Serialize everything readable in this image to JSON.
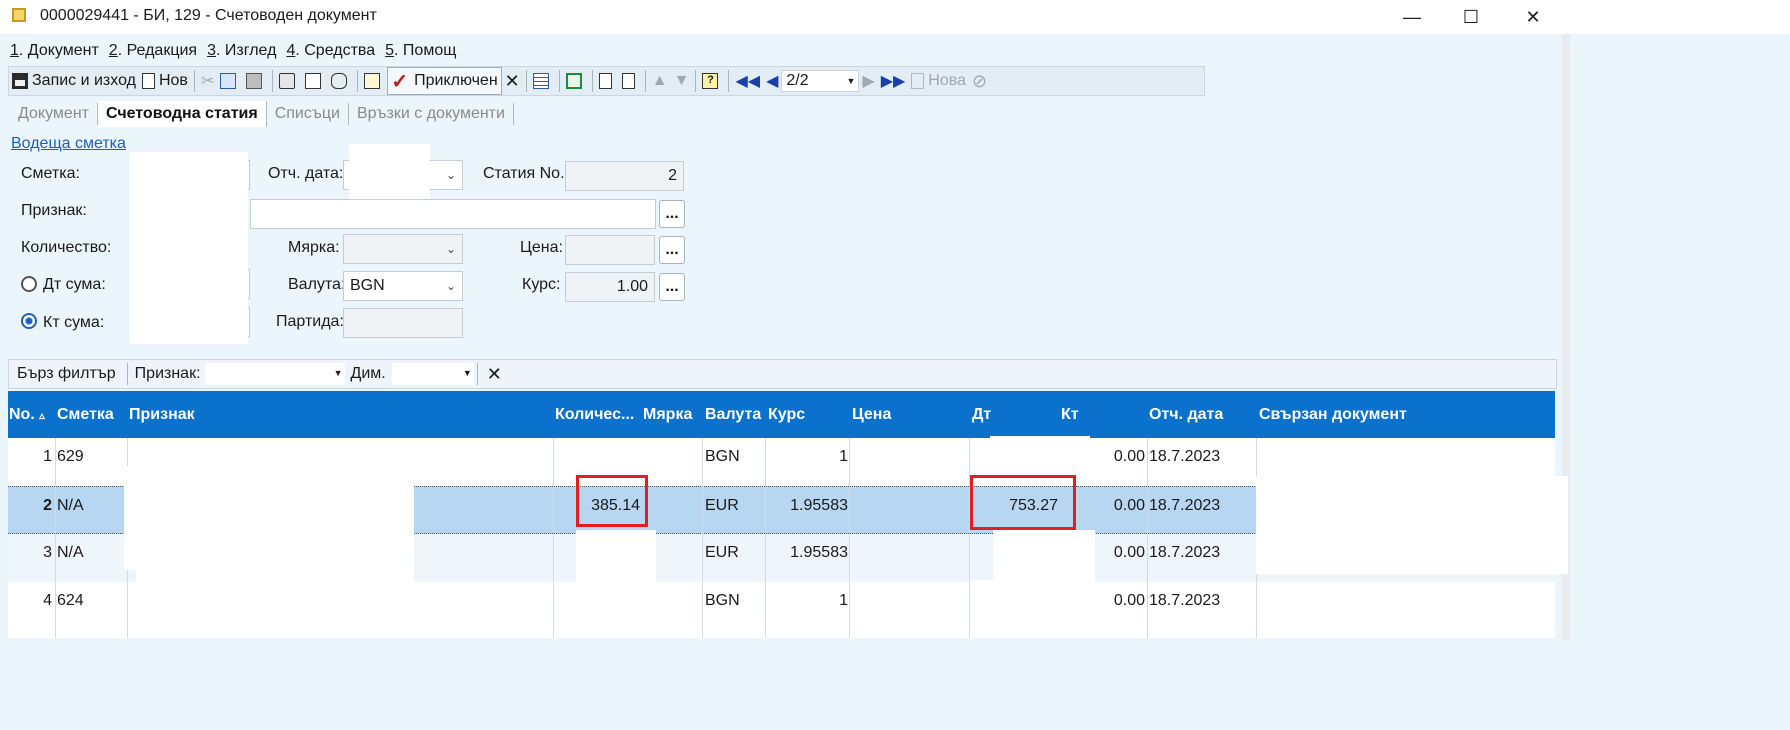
{
  "window": {
    "title": "0000029441 - БИ, 129 - Счетоводен документ",
    "min_glyph": "—",
    "max_glyph": "☐",
    "close_glyph": "✕"
  },
  "menu": [
    {
      "key": "1",
      "label": ". Документ"
    },
    {
      "key": "2",
      "label": ". Редакция"
    },
    {
      "key": "3",
      "label": ". Изглед"
    },
    {
      "key": "4",
      "label": ". Средства"
    },
    {
      "key": "5",
      "label": ". Помощ"
    }
  ],
  "toolbar": {
    "save_exit": "Запис и изход",
    "new": "Нов",
    "finished": "Приключен",
    "page": "2/2",
    "new_disabled": "Нова"
  },
  "tabs": [
    "Документ",
    "Счетоводна статия",
    "Списъци",
    "Връзки с документи"
  ],
  "form": {
    "section_link": "Водеща сметка",
    "account_label": "Сметка:",
    "report_date_label": "Отч. дата:",
    "entry_no_label": "Статия No.",
    "entry_no_value": "2",
    "attribute_label": "Признак:",
    "quantity_label": "Количество:",
    "unit_label": "Мярка:",
    "price_label": "Цена:",
    "dt_sum_label": "Дт сума:",
    "currency_label": "Валута:",
    "currency_value": "BGN",
    "rate_label": "Курс:",
    "rate_value": "1.00",
    "kt_sum_label": "Кт сума:",
    "batch_label": "Партида:",
    "kt_selected": true,
    "dots": "..."
  },
  "filter": {
    "quick_filter": "Бърз филтър",
    "attribute_label": "Признак:",
    "dim_label": "Дим.",
    "clear_glyph": "✕"
  },
  "grid": {
    "sort_glyph": "▵",
    "columns": [
      "No.",
      "Сметка",
      "Признак",
      "Количес...",
      "Мярка",
      "Валута",
      "Курс",
      "Цена",
      "Дт",
      "Кт",
      "Отч. дата",
      "Свързан документ"
    ],
    "rows": [
      {
        "no": "1",
        "account": "629",
        "qty": "",
        "currency": "BGN",
        "rate": "1",
        "dt": "",
        "kt": "0.00",
        "date": "18.7.2023"
      },
      {
        "no": "2",
        "account": "N/A",
        "qty": "385.14",
        "currency": "EUR",
        "rate": "1.95583",
        "dt": "753.27",
        "kt": "0.00",
        "date": "18.7.2023"
      },
      {
        "no": "3",
        "account": "N/A",
        "qty": "",
        "currency": "EUR",
        "rate": "1.95583",
        "dt": "",
        "kt": "0.00",
        "date": "18.7.2023"
      },
      {
        "no": "4",
        "account": "624",
        "qty": "",
        "currency": "BGN",
        "rate": "1",
        "dt": "",
        "kt": "0.00",
        "date": "18.7.2023"
      }
    ]
  },
  "colors": {
    "grid_header": "#0a72cc",
    "selected_row": "#b6d6f2",
    "highlight_box": "#e02020"
  }
}
